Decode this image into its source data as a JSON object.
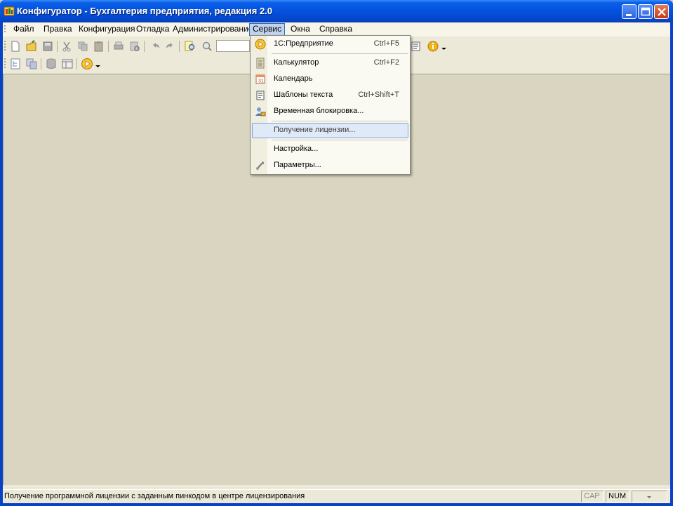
{
  "window": {
    "title": "Конфигуратор - Бухгалтерия предприятия, редакция 2.0"
  },
  "menubar": {
    "items": [
      {
        "label": "Файл",
        "hotkey_index": 0
      },
      {
        "label": "Правка",
        "hotkey_index": 0
      },
      {
        "label": "Конфигурация",
        "hotkey_index": 0
      },
      {
        "label": "Отладка",
        "hotkey_index": 0
      },
      {
        "label": "Администрирование",
        "hotkey_index": 0
      },
      {
        "label": "Сервис",
        "hotkey_index": 0,
        "active": true
      },
      {
        "label": "Окна",
        "hotkey_index": 0
      },
      {
        "label": "Справка",
        "hotkey_index": 0
      }
    ]
  },
  "service_menu": {
    "items": [
      {
        "label": "1С:Предприятие",
        "shortcut": "Ctrl+F5",
        "icon": "play-circle-icon"
      },
      {
        "label": "Калькулятор",
        "shortcut": "Ctrl+F2",
        "icon": "calculator-icon"
      },
      {
        "label": "Календарь",
        "shortcut": "",
        "icon": "calendar-icon"
      },
      {
        "label": "Шаблоны текста",
        "shortcut": "Ctrl+Shift+T",
        "icon": "text-templates-icon"
      },
      {
        "label": "Временная блокировка...",
        "shortcut": "",
        "icon": "user-lock-icon"
      },
      {
        "label": "Получение лицензии...",
        "shortcut": "",
        "icon": "",
        "highlighted": true
      },
      {
        "label": "Настройка...",
        "shortcut": "",
        "icon": ""
      },
      {
        "label": "Параметры...",
        "shortcut": "",
        "icon": "wrench-icon"
      }
    ]
  },
  "statusbar": {
    "message": "Получение программной лицензии с заданным пинкодом в центре лицензирования",
    "cap": "CAP",
    "num": "NUM"
  },
  "colors": {
    "title_bar": "#0553de",
    "menu_highlight": "#c1d2ee",
    "workspace": "#d9d5c0",
    "shortcut_accent": "#b08a10"
  }
}
